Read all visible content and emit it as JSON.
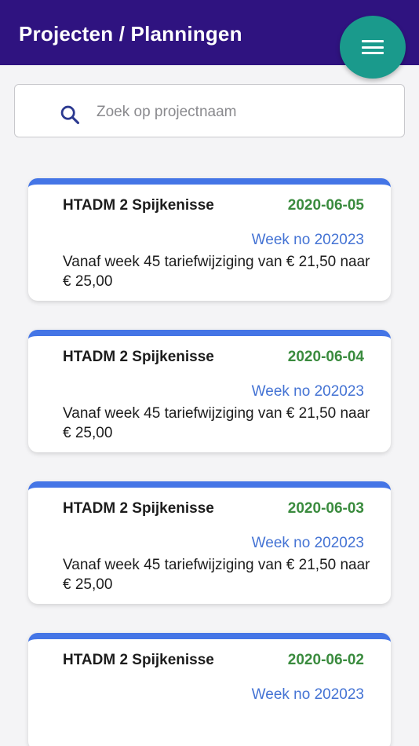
{
  "header": {
    "title": "Projecten / Planningen",
    "menu_icon": "hamburger-menu-icon",
    "background_color": "#2f1380",
    "fab_color": "#1a9a8c"
  },
  "search": {
    "icon": "search-icon",
    "placeholder": "Zoek op projectnaam",
    "value": ""
  },
  "cards": [
    {
      "project": "HTADM 2 Spijkenisse",
      "date": "2020-06-05",
      "week": "Week no 202023",
      "description": "Vanaf week 45 tariefwijziging van € 21,50 naar € 25,00"
    },
    {
      "project": "HTADM 2 Spijkenisse",
      "date": "2020-06-04",
      "week": "Week no 202023",
      "description": "Vanaf week 45 tariefwijziging van € 21,50 naar € 25,00"
    },
    {
      "project": "HTADM 2 Spijkenisse",
      "date": "2020-06-03",
      "week": "Week no 202023",
      "description": "Vanaf week 45 tariefwijziging van € 21,50 naar € 25,00"
    },
    {
      "project": "HTADM 2 Spijkenisse",
      "date": "2020-06-02",
      "week": "Week no 202023",
      "description": ""
    }
  ],
  "colors": {
    "card_accent": "#4475e6",
    "date_green": "#3a8b3e",
    "week_blue": "#4473d4"
  }
}
